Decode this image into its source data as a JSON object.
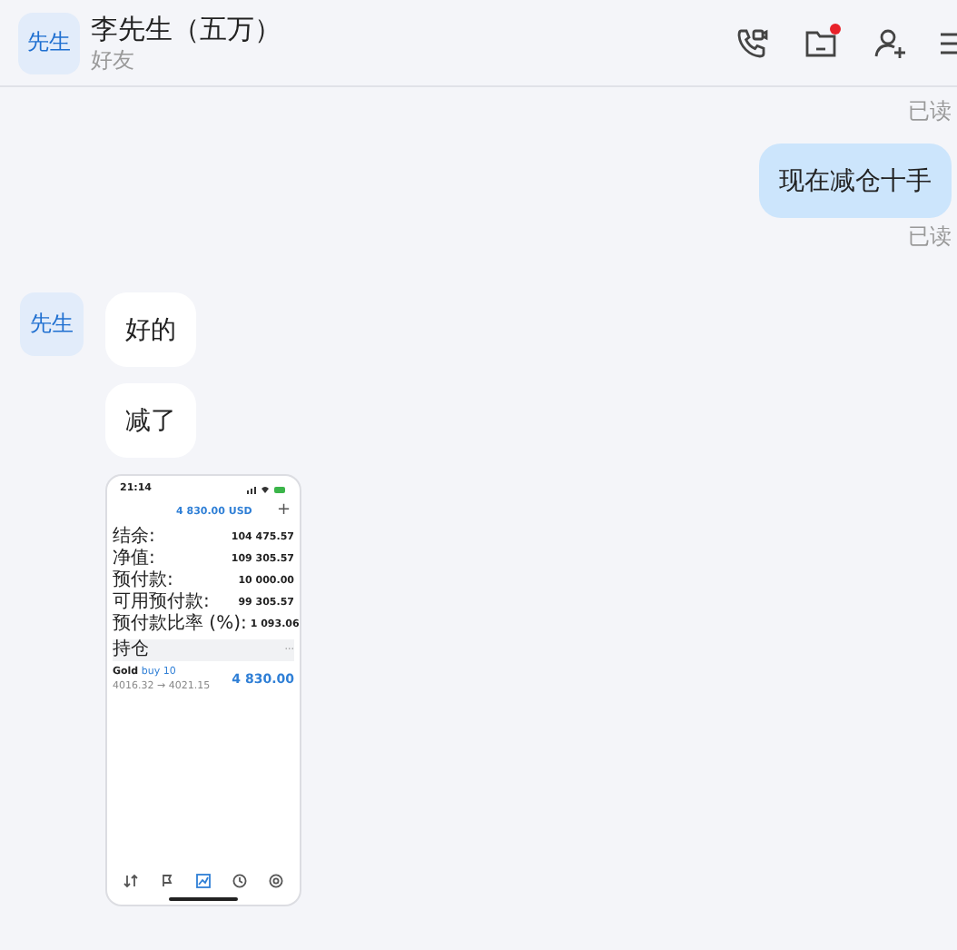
{
  "header": {
    "avatar_text": "先生",
    "name": "李先生（五万）",
    "status": "好友",
    "actions": [
      {
        "kind": "call",
        "badge": false
      },
      {
        "kind": "folder",
        "badge": true
      },
      {
        "kind": "add-user",
        "badge": false
      },
      {
        "kind": "menu",
        "badge": false
      }
    ]
  },
  "messages": [
    {
      "kind": "receipt",
      "text": "已读"
    },
    {
      "kind": "outgoing",
      "text": "现在减仓十手"
    },
    {
      "kind": "receipt",
      "text": "已读"
    },
    {
      "kind": "incoming",
      "avatar": "先生",
      "text": "好的"
    },
    {
      "kind": "incoming",
      "text": "减了"
    },
    {
      "kind": "screenshot",
      "phone": {
        "time": "21:14",
        "title": "4 830.00 USD",
        "add": "+",
        "rows": [
          {
            "label": "结余:",
            "value": "104 475.57"
          },
          {
            "label": "净值:",
            "value": "109 305.57"
          },
          {
            "label": "预付款:",
            "value": "10 000.00"
          },
          {
            "label": "可用预付款:",
            "value": "99 305.57"
          },
          {
            "label": "预付款比率 (%):",
            "value": "1 093.06"
          }
        ],
        "section": "持仓",
        "more": "···",
        "position": {
          "symbol": "Gold",
          "side": "buy 10",
          "prices": "4016.32 → 4021.15",
          "profit": "4 830.00"
        },
        "tabs": [
          {
            "kind": "trade",
            "selected": false
          },
          {
            "kind": "flag",
            "selected": false
          },
          {
            "kind": "chart",
            "selected": true
          },
          {
            "kind": "history",
            "selected": false
          },
          {
            "kind": "settings",
            "selected": false
          }
        ]
      }
    }
  ]
}
